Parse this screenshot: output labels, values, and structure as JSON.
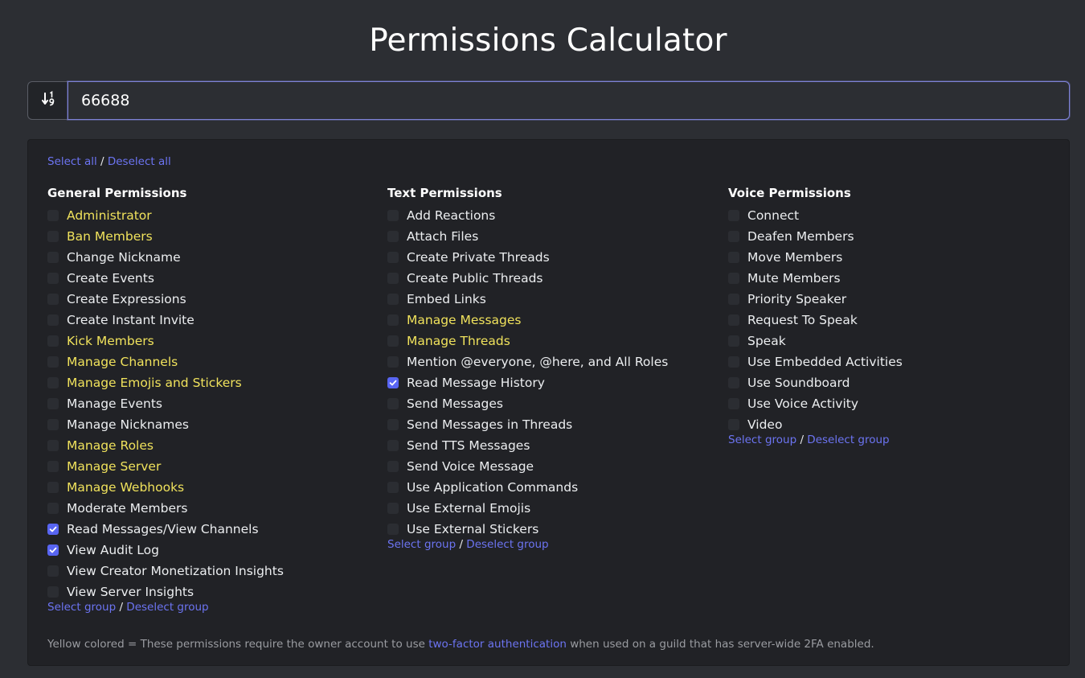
{
  "title": "Permissions Calculator",
  "input": {
    "value": "66688"
  },
  "select_all": {
    "select_label": "Select all",
    "separator": "/",
    "deselect_label": "Deselect all"
  },
  "group_actions": {
    "select_label": "Select group",
    "separator": "/",
    "deselect_label": "Deselect group"
  },
  "colors": {
    "warn": "#f0e25c",
    "link": "#6c74f2",
    "checked": "#5865f2"
  },
  "columns": [
    {
      "heading": "General Permissions",
      "items": [
        {
          "label": "Administrator",
          "checked": false,
          "warn": true
        },
        {
          "label": "Ban Members",
          "checked": false,
          "warn": true
        },
        {
          "label": "Change Nickname",
          "checked": false,
          "warn": false
        },
        {
          "label": "Create Events",
          "checked": false,
          "warn": false
        },
        {
          "label": "Create Expressions",
          "checked": false,
          "warn": false
        },
        {
          "label": "Create Instant Invite",
          "checked": false,
          "warn": false
        },
        {
          "label": "Kick Members",
          "checked": false,
          "warn": true
        },
        {
          "label": "Manage Channels",
          "checked": false,
          "warn": true
        },
        {
          "label": "Manage Emojis and Stickers",
          "checked": false,
          "warn": true
        },
        {
          "label": "Manage Events",
          "checked": false,
          "warn": false
        },
        {
          "label": "Manage Nicknames",
          "checked": false,
          "warn": false
        },
        {
          "label": "Manage Roles",
          "checked": false,
          "warn": true
        },
        {
          "label": "Manage Server",
          "checked": false,
          "warn": true
        },
        {
          "label": "Manage Webhooks",
          "checked": false,
          "warn": true
        },
        {
          "label": "Moderate Members",
          "checked": false,
          "warn": false
        },
        {
          "label": "Read Messages/View Channels",
          "checked": true,
          "warn": false
        },
        {
          "label": "View Audit Log",
          "checked": true,
          "warn": false
        },
        {
          "label": "View Creator Monetization Insights",
          "checked": false,
          "warn": false
        },
        {
          "label": "View Server Insights",
          "checked": false,
          "warn": false
        }
      ]
    },
    {
      "heading": "Text Permissions",
      "items": [
        {
          "label": "Add Reactions",
          "checked": false,
          "warn": false
        },
        {
          "label": "Attach Files",
          "checked": false,
          "warn": false
        },
        {
          "label": "Create Private Threads",
          "checked": false,
          "warn": false
        },
        {
          "label": "Create Public Threads",
          "checked": false,
          "warn": false
        },
        {
          "label": "Embed Links",
          "checked": false,
          "warn": false
        },
        {
          "label": "Manage Messages",
          "checked": false,
          "warn": true
        },
        {
          "label": "Manage Threads",
          "checked": false,
          "warn": true
        },
        {
          "label": "Mention @everyone, @here, and All Roles",
          "checked": false,
          "warn": false
        },
        {
          "label": "Read Message History",
          "checked": true,
          "warn": false
        },
        {
          "label": "Send Messages",
          "checked": false,
          "warn": false
        },
        {
          "label": "Send Messages in Threads",
          "checked": false,
          "warn": false
        },
        {
          "label": "Send TTS Messages",
          "checked": false,
          "warn": false
        },
        {
          "label": "Send Voice Message",
          "checked": false,
          "warn": false
        },
        {
          "label": "Use Application Commands",
          "checked": false,
          "warn": false
        },
        {
          "label": "Use External Emojis",
          "checked": false,
          "warn": false
        },
        {
          "label": "Use External Stickers",
          "checked": false,
          "warn": false
        }
      ]
    },
    {
      "heading": "Voice Permissions",
      "items": [
        {
          "label": "Connect",
          "checked": false,
          "warn": false
        },
        {
          "label": "Deafen Members",
          "checked": false,
          "warn": false
        },
        {
          "label": "Move Members",
          "checked": false,
          "warn": false
        },
        {
          "label": "Mute Members",
          "checked": false,
          "warn": false
        },
        {
          "label": "Priority Speaker",
          "checked": false,
          "warn": false
        },
        {
          "label": "Request To Speak",
          "checked": false,
          "warn": false
        },
        {
          "label": "Speak",
          "checked": false,
          "warn": false
        },
        {
          "label": "Use Embedded Activities",
          "checked": false,
          "warn": false
        },
        {
          "label": "Use Soundboard",
          "checked": false,
          "warn": false
        },
        {
          "label": "Use Voice Activity",
          "checked": false,
          "warn": false
        },
        {
          "label": "Video",
          "checked": false,
          "warn": false
        }
      ]
    }
  ],
  "footnote": {
    "before": "Yellow colored = These permissions require the owner account to use ",
    "link": "two-factor authentication",
    "after": " when used on a guild that has server-wide 2FA enabled."
  }
}
